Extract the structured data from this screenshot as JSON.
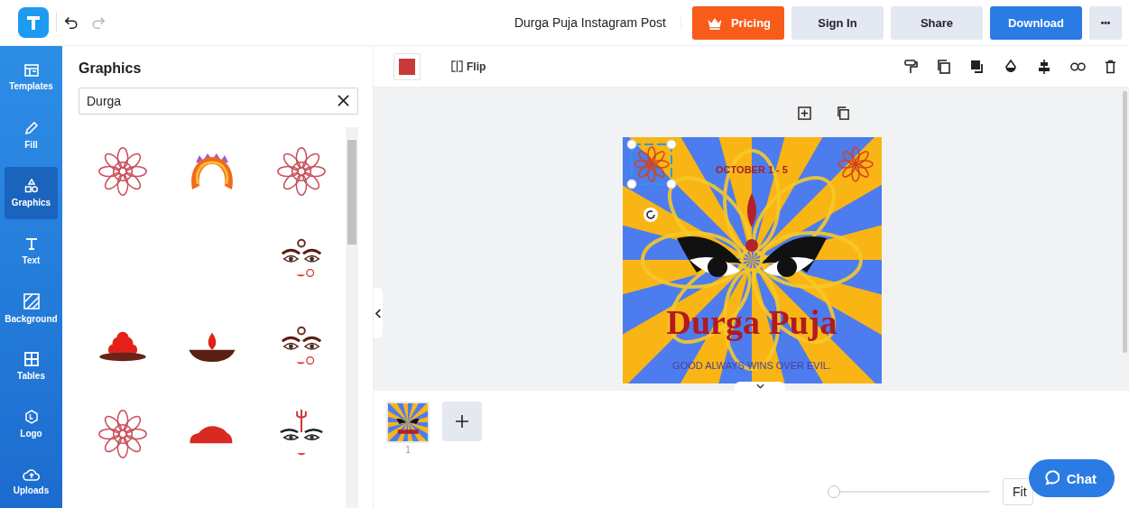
{
  "header": {
    "undo_enabled": true,
    "redo_enabled": false,
    "document_title": "Durga Puja Instagram Post",
    "buttons": [
      {
        "label": "Pricing",
        "kind": "pricing"
      },
      {
        "label": "Sign In",
        "kind": "plain"
      },
      {
        "label": "Share",
        "kind": "plain"
      },
      {
        "label": "Download",
        "kind": "primary"
      },
      {
        "label": "•••",
        "kind": "more"
      }
    ]
  },
  "sidebar": {
    "items": [
      {
        "label": "Templates",
        "kind": "templates",
        "selected": false
      },
      {
        "label": "Fill",
        "kind": "fill",
        "selected": false
      },
      {
        "label": "Graphics",
        "kind": "graphics",
        "selected": true
      },
      {
        "label": "Text",
        "kind": "text",
        "selected": false
      },
      {
        "label": "Background",
        "kind": "background",
        "selected": false
      },
      {
        "label": "Tables",
        "kind": "tables",
        "selected": false
      },
      {
        "label": "Logo",
        "kind": "logo",
        "selected": false
      },
      {
        "label": "Uploads",
        "kind": "uploads",
        "selected": false
      }
    ]
  },
  "panel": {
    "title": "Graphics",
    "search": {
      "value": "Durga"
    },
    "graphics": [
      {
        "kind": "mandala"
      },
      {
        "kind": "crown"
      },
      {
        "kind": "mandala"
      },
      {
        "kind": "blank"
      },
      {
        "kind": "blank"
      },
      {
        "kind": "face"
      },
      {
        "kind": "sweets"
      },
      {
        "kind": "lamp"
      },
      {
        "kind": "face"
      },
      {
        "kind": "mandala"
      },
      {
        "kind": "powder"
      },
      {
        "kind": "trident-face"
      }
    ]
  },
  "toolbar": {
    "color": "#c83a3a",
    "flip_label": "Flip"
  },
  "poster": {
    "date": "OCTOBER 1 - 5",
    "title": "Durga Puja",
    "tagline": "GOOD ALWAYS WINS OVER EVIL."
  },
  "pages": [
    {
      "number": "1",
      "selected": true
    }
  ],
  "zoom": {
    "level": 0.04,
    "fit_label": "Fit"
  },
  "chat": {
    "label": "Chat"
  }
}
